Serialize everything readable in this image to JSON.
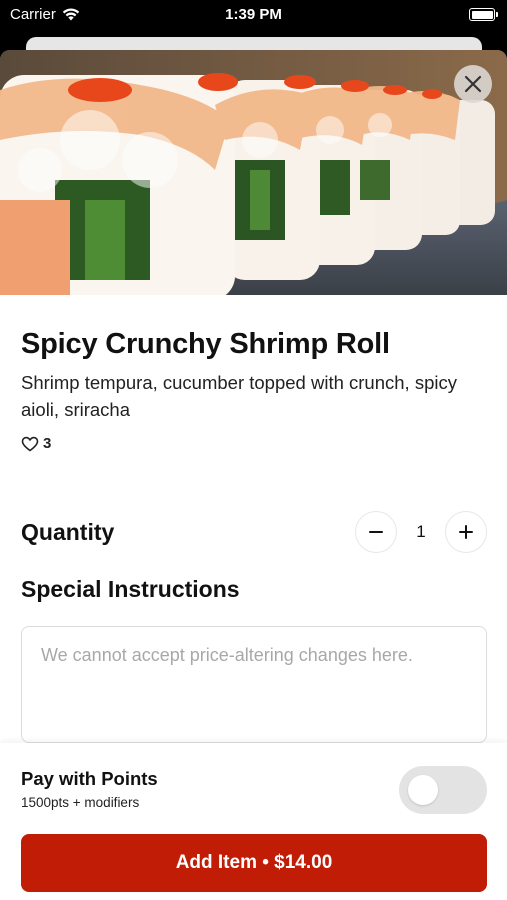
{
  "status_bar": {
    "carrier": "Carrier",
    "time": "1:39 PM"
  },
  "item": {
    "title": "Spicy Crunchy Shrimp Roll",
    "description": "Shrimp tempura, cucumber topped with crunch, spicy aioli, sriracha",
    "likes": "3"
  },
  "quantity": {
    "label": "Quantity",
    "value": "1"
  },
  "instructions": {
    "label": "Special Instructions",
    "placeholder": "We cannot accept price-altering changes here."
  },
  "points": {
    "title": "Pay with Points",
    "subtitle": "1500pts + modifiers",
    "enabled": false
  },
  "cta": {
    "label": "Add Item • $14.00"
  },
  "colors": {
    "accent": "#c01c06",
    "toggle_off": "#e3e3e3"
  }
}
